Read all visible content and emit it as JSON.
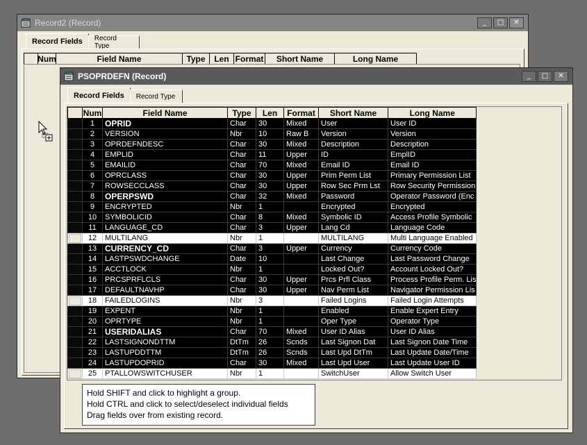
{
  "back_window": {
    "title": "Record2 (Record)",
    "tabs": [
      "Record Fields",
      "Record Type"
    ],
    "columns": [
      "",
      "Num",
      "Field Name",
      "Type",
      "Len",
      "Format",
      "Short Name",
      "Long Name"
    ],
    "buttons": {
      "minimize": "_",
      "maximize": "□",
      "close": "✕"
    }
  },
  "front_window": {
    "title": "PSOPRDEFN (Record)",
    "tabs": [
      "Record Fields",
      "Record Type"
    ],
    "columns": [
      "",
      "Num",
      "Field Name",
      "Type",
      "Len",
      "Format",
      "Short Name",
      "Long Name"
    ],
    "buttons": {
      "minimize": "_",
      "maximize": "□",
      "close": "✕"
    },
    "rows": [
      {
        "num": "1",
        "field": "OPRID",
        "type": "Char",
        "len": "30",
        "format": "Mixed",
        "short": "User",
        "long": "User ID",
        "selected": true,
        "bold": true
      },
      {
        "num": "2",
        "field": "VERSION",
        "type": "Nbr",
        "len": "10",
        "format": "Raw B",
        "short": "Version",
        "long": "Version",
        "selected": true,
        "bold": false
      },
      {
        "num": "3",
        "field": "OPRDEFNDESC",
        "type": "Char",
        "len": "30",
        "format": "Mixed",
        "short": "Description",
        "long": "Description",
        "selected": true,
        "bold": false
      },
      {
        "num": "4",
        "field": "EMPLID",
        "type": "Char",
        "len": "11",
        "format": "Upper",
        "short": "ID",
        "long": "EmplID",
        "selected": true,
        "bold": false
      },
      {
        "num": "5",
        "field": "EMAILID",
        "type": "Char",
        "len": "70",
        "format": "Mixed",
        "short": "Email ID",
        "long": "Email ID",
        "selected": true,
        "bold": false
      },
      {
        "num": "6",
        "field": "OPRCLASS",
        "type": "Char",
        "len": "30",
        "format": "Upper",
        "short": "Prim Perm List",
        "long": "Primary Permission List",
        "selected": true,
        "bold": false
      },
      {
        "num": "7",
        "field": "ROWSECCLASS",
        "type": "Char",
        "len": "30",
        "format": "Upper",
        "short": "Row Sec Prm Lst",
        "long": "Row Security Permission",
        "selected": true,
        "bold": false
      },
      {
        "num": "8",
        "field": "OPERPSWD",
        "type": "Char",
        "len": "32",
        "format": "Mixed",
        "short": "Password",
        "long": "Operator Password (Enc",
        "selected": true,
        "bold": true
      },
      {
        "num": "9",
        "field": "ENCRYPTED",
        "type": "Nbr",
        "len": "1",
        "format": "",
        "short": "Encrypted",
        "long": "Encrypted",
        "selected": true,
        "bold": false
      },
      {
        "num": "10",
        "field": "SYMBOLICID",
        "type": "Char",
        "len": "8",
        "format": "Mixed",
        "short": "Symbolic ID",
        "long": "Access Profile Symbolic",
        "selected": true,
        "bold": false
      },
      {
        "num": "11",
        "field": "LANGUAGE_CD",
        "type": "Char",
        "len": "3",
        "format": "Upper",
        "short": "Lang Cd",
        "long": "Language Code",
        "selected": true,
        "bold": false
      },
      {
        "num": "12",
        "field": "MULTILANG",
        "type": "Nbr",
        "len": "1",
        "format": "",
        "short": "MULTILANG",
        "long": "Multi Language Enabled",
        "selected": false,
        "bold": false
      },
      {
        "num": "13",
        "field": "CURRENCY_CD",
        "type": "Char",
        "len": "3",
        "format": "Upper",
        "short": "Currency",
        "long": "Currency Code",
        "selected": true,
        "bold": true
      },
      {
        "num": "14",
        "field": "LASTPSWDCHANGE",
        "type": "Date",
        "len": "10",
        "format": "",
        "short": "Last Change",
        "long": "Last Password Change",
        "selected": true,
        "bold": false
      },
      {
        "num": "15",
        "field": "ACCTLOCK",
        "type": "Nbr",
        "len": "1",
        "format": "",
        "short": "Locked Out?",
        "long": "Account Locked Out?",
        "selected": true,
        "bold": false
      },
      {
        "num": "16",
        "field": "PRCSPRFLCLS",
        "type": "Char",
        "len": "30",
        "format": "Upper",
        "short": "Prcs Prfl Class",
        "long": "Process Profile Perm. Lis",
        "selected": true,
        "bold": false
      },
      {
        "num": "17",
        "field": "DEFAULTNAVHP",
        "type": "Char",
        "len": "30",
        "format": "Upper",
        "short": "Nav Perm List",
        "long": "Navigator Permission Lis",
        "selected": true,
        "bold": false
      },
      {
        "num": "18",
        "field": "FAILEDLOGINS",
        "type": "Nbr",
        "len": "3",
        "format": "",
        "short": "Failed Logins",
        "long": "Failed Login Attempts",
        "selected": false,
        "bold": false
      },
      {
        "num": "19",
        "field": "EXPENT",
        "type": "Nbr",
        "len": "1",
        "format": "",
        "short": "Enabled",
        "long": "Enable Expert Entry",
        "selected": true,
        "bold": false
      },
      {
        "num": "20",
        "field": "OPRTYPE",
        "type": "Nbr",
        "len": "1",
        "format": "",
        "short": "Oper Type",
        "long": "Operator Type",
        "selected": true,
        "bold": false
      },
      {
        "num": "21",
        "field": "USERIDALIAS",
        "type": "Char",
        "len": "70",
        "format": "Mixed",
        "short": "User ID Alias",
        "long": "User ID Alias",
        "selected": true,
        "bold": true
      },
      {
        "num": "22",
        "field": "LASTSIGNONDTTM",
        "type": "DtTm",
        "len": "26",
        "format": "Scnds",
        "short": "Last Signon Dat",
        "long": "Last Signon Date Time",
        "selected": true,
        "bold": false
      },
      {
        "num": "23",
        "field": "LASTUPDDTTM",
        "type": "DtTm",
        "len": "26",
        "format": "Scnds",
        "short": "Last Upd DtTm",
        "long": "Last Update Date/Time",
        "selected": true,
        "bold": false
      },
      {
        "num": "24",
        "field": "LASTUPDOPRID",
        "type": "Char",
        "len": "30",
        "format": "Mixed",
        "short": "Last Upd User",
        "long": "Last Update User ID",
        "selected": true,
        "bold": false
      },
      {
        "num": "25",
        "field": "PTALLOWSWITCHUSER",
        "type": "Nbr",
        "len": "1",
        "format": "",
        "short": "SwitchUser",
        "long": "Allow Switch User",
        "selected": false,
        "bold": false
      }
    ],
    "hint_lines": [
      "Hold SHIFT and click to highlight a group.",
      "Hold CTRL and click to select/deselect individual fields",
      "Drag fields over from existing record."
    ]
  },
  "colors": {
    "selected_row": "#000000",
    "unselected_row": "#ffffff",
    "window_bg": "#ece9d8",
    "desktop": "#6e6e6e"
  }
}
